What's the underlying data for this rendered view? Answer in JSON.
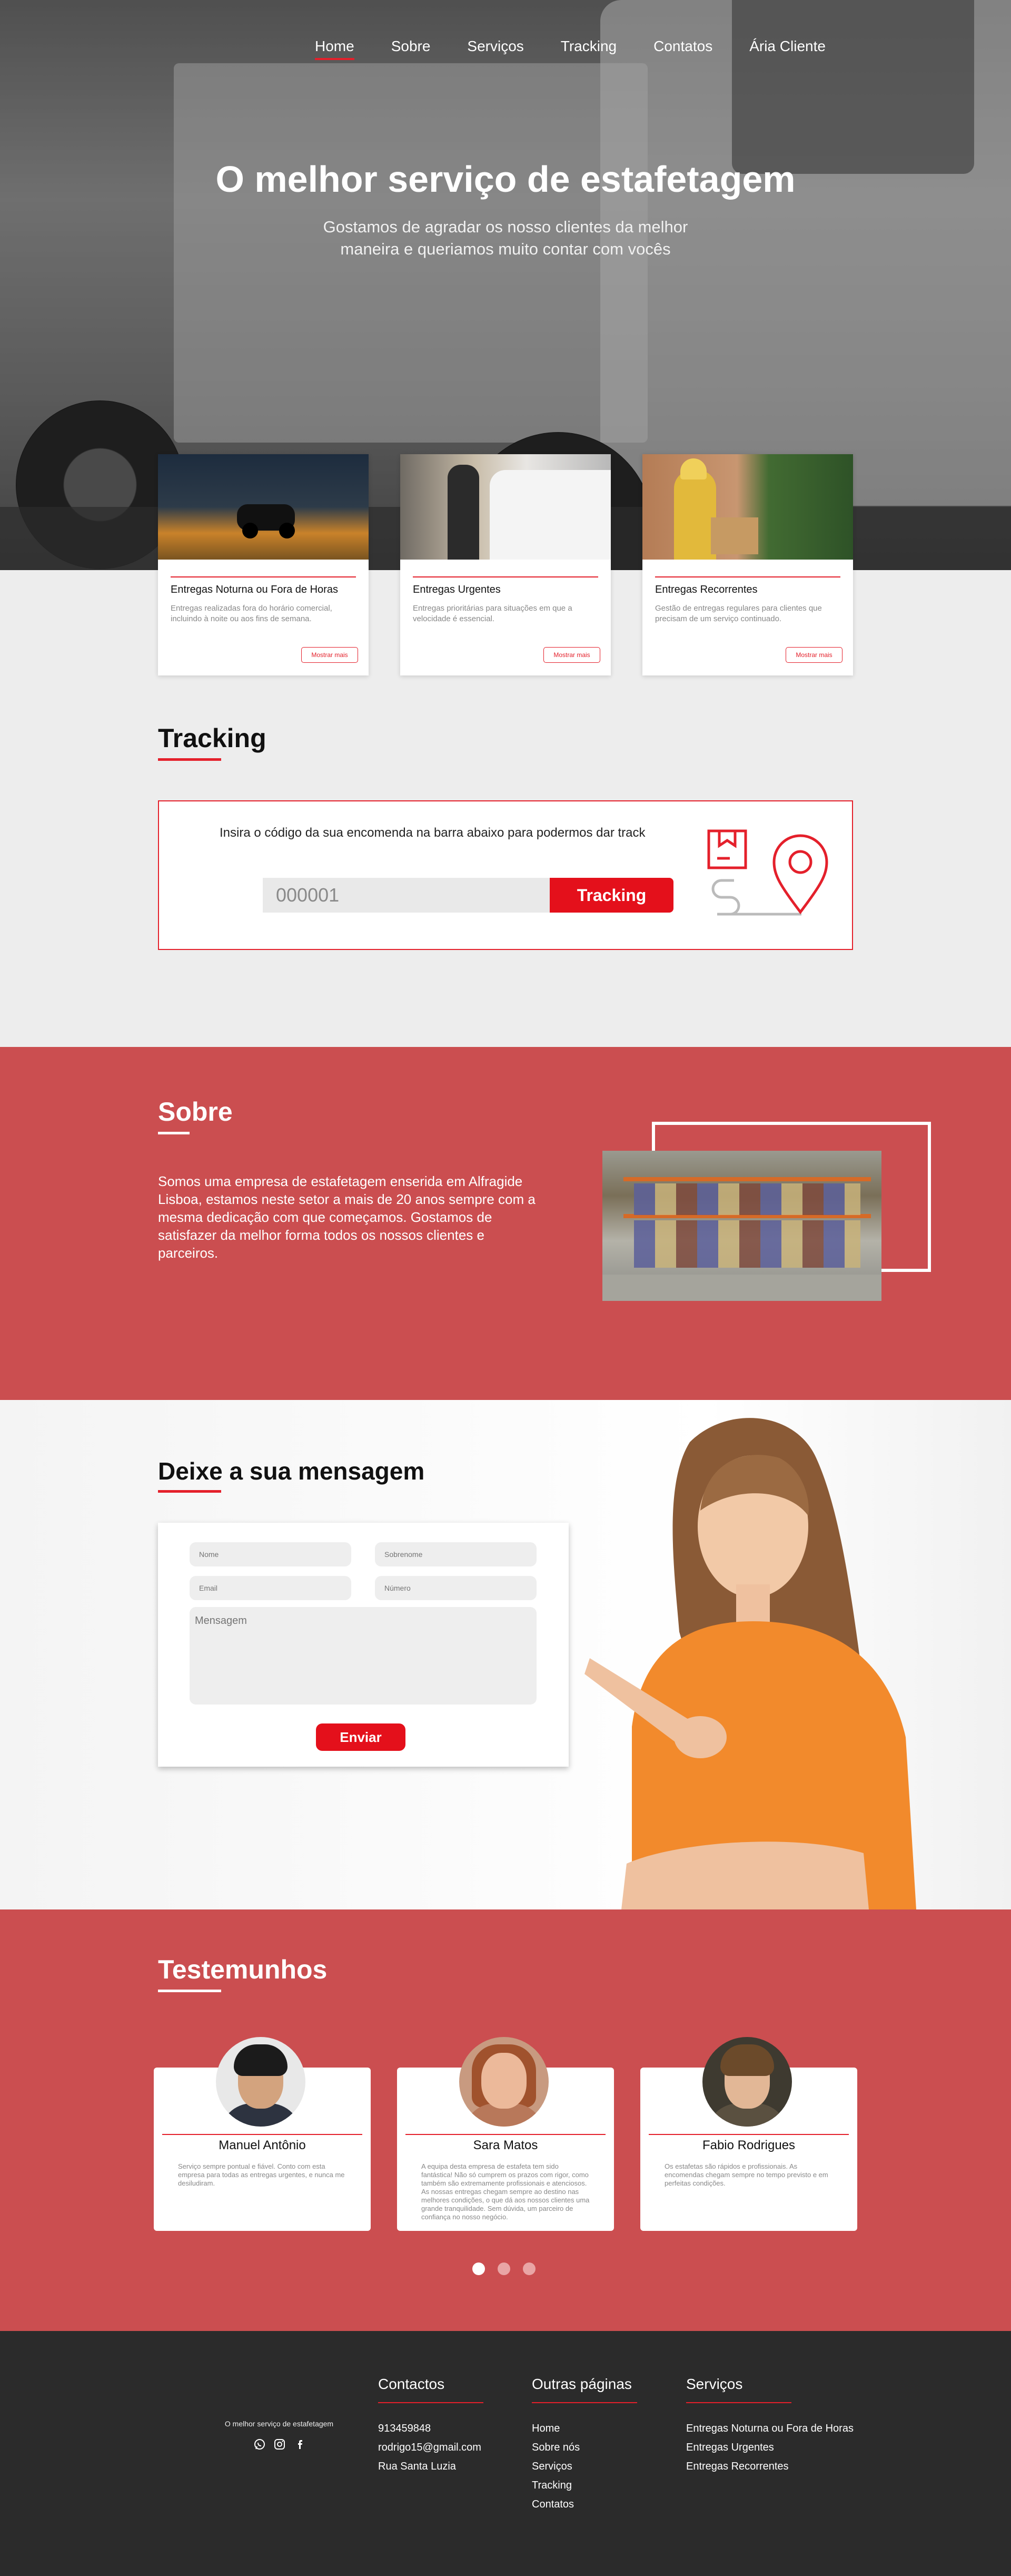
{
  "nav": {
    "items": [
      {
        "label": "Home"
      },
      {
        "label": "Sobre"
      },
      {
        "label": "Serviços"
      },
      {
        "label": "Tracking"
      },
      {
        "label": "Contatos"
      },
      {
        "label": "Ária Cliente"
      }
    ]
  },
  "hero": {
    "title": "O melhor serviço de estafetagem",
    "subtitle": "Gostamos de agradar os nosso clientes da melhor maneira e queriamos muito contar com vocês"
  },
  "services": [
    {
      "title": "Entregas Noturna ou Fora de Horas",
      "text": "Entregas realizadas fora do horário comercial, incluindo à noite ou aos fins de semana.",
      "button": "Mostrar mais"
    },
    {
      "title": "Entregas Urgentes",
      "text": "Entregas prioritárias para situações em que a velocidade é essencial.",
      "button": "Mostrar mais"
    },
    {
      "title": "Entregas Recorrentes",
      "text": "Gestão de entregas regulares para clientes que precisam de um serviço continuado.",
      "button": "Mostrar mais"
    }
  ],
  "tracking": {
    "title": "Tracking",
    "intro": "Insira o código da sua encomenda na barra abaixo para podermos dar track",
    "input_value": "000001",
    "button": "Tracking"
  },
  "sobre": {
    "title": "Sobre",
    "text": "Somos uma empresa de estafetagem enserida em Alfragide Lisboa, estamos neste setor a mais de 20 anos sempre com a mesma dedicação com que começamos. Gostamos de satisfazer da melhor forma todos os nossos clientes e parceiros."
  },
  "mensagem": {
    "title": "Deixe a sua mensagem",
    "nome": "Nome",
    "sobrenome": "Sobrenome",
    "email": "Email",
    "numero": "Número",
    "mensagem": "Mensagem",
    "button": "Enviar"
  },
  "testemunhos": {
    "title": "Testemunhos",
    "items": [
      {
        "name": "Manuel Antônio",
        "text": "Serviço sempre pontual e fiável. Conto com esta empresa para todas as entregas urgentes, e nunca me desiludiram."
      },
      {
        "name": "Sara Matos",
        "text": "A equipa desta empresa de estafeta tem sido fantástica! Não só cumprem os prazos com rigor, como também são extremamente profissionais e atenciosos. As nossas entregas chegam sempre ao destino nas melhores condições, o que dá aos nossos clientes uma grande tranquilidade. Sem dúvida, um parceiro de confiança no nosso negócio."
      },
      {
        "name": "Fabio Rodrigues",
        "text": "Os estafetas são rápidos e profissionais. As encomendas chegam sempre no tempo previsto e em perfeitas condições."
      }
    ]
  },
  "footer": {
    "brand": "O melhor serviço de estafetagem",
    "contactos": {
      "title": "Contactos",
      "phone": "913459848",
      "email": "rodrigo15@gmail.com",
      "address": "Rua Santa Luzia"
    },
    "paginas": {
      "title": "Outras páginas",
      "items": [
        "Home",
        "Sobre nós",
        "Serviços",
        "Tracking",
        "Contatos"
      ]
    },
    "servicos": {
      "title": "Serviços",
      "items": [
        "Entregas Noturna ou Fora de Horas",
        "Entregas Urgentes",
        "Entregas Recorrentes"
      ]
    }
  },
  "colors": {
    "accent": "#e4202b",
    "section_red": "#cb4e50",
    "footer_bg": "#2b2b2b"
  },
  "icons": [
    "whatsapp-icon",
    "instagram-icon",
    "facebook-icon",
    "package-icon",
    "location-pin-icon"
  ]
}
